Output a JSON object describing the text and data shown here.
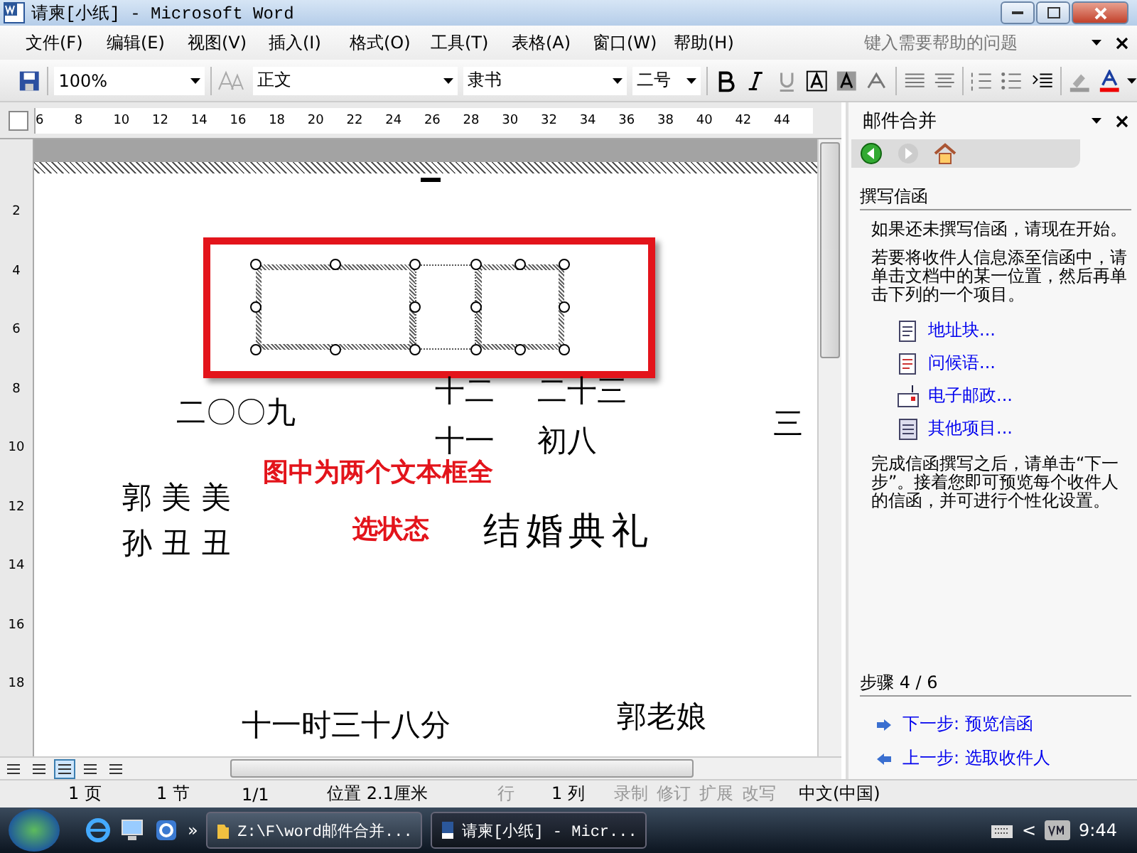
{
  "window": {
    "title": "请柬[小纸] - Microsoft Word"
  },
  "menu": {
    "items": [
      "文件(F)",
      "编辑(E)",
      "视图(V)",
      "插入(I)",
      "格式(O)",
      "工具(T)",
      "表格(A)",
      "窗口(W)",
      "帮助(H)"
    ],
    "help_placeholder": "键入需要帮助的问题"
  },
  "toolbar": {
    "zoom": "100%",
    "style": "正文",
    "font": "隶书",
    "size": "二号"
  },
  "ruler": {
    "ticks": [
      "6",
      "8",
      "10",
      "12",
      "14",
      "16",
      "18",
      "20",
      "22",
      "24",
      "26",
      "28",
      "30",
      "32",
      "34",
      "36",
      "38",
      "40",
      "42",
      "44"
    ],
    "vertical_ticks": [
      "2",
      "4",
      "6",
      "8",
      "10",
      "12",
      "14",
      "16",
      "18"
    ]
  },
  "document": {
    "texts": [
      "十二",
      "二十三",
      "十一",
      "初八",
      "二〇〇九",
      "三",
      "郭 美 美",
      "孙 丑 丑",
      "结婚典礼",
      "十一时三十八分",
      "郭老娘"
    ],
    "text_boxes": [
      {
        "selected": true
      },
      {
        "selected": true
      }
    ],
    "annotation": {
      "lines": [
        "图中为两个文本框全",
        "选状态"
      ]
    }
  },
  "view_buttons": [
    {
      "selected": false
    },
    {
      "selected": false
    },
    {
      "selected": true
    },
    {
      "selected": false
    },
    {
      "selected": false
    }
  ],
  "task_pane": {
    "title": "邮件合并",
    "section": "撰写信函",
    "intro": [
      "如果还未撰写信函，请现在开始。",
      "若要将收件人信息添至信函中，请单击文档中的某一位置，然后再单击下列的一个项目。"
    ],
    "links": [
      {
        "kind": "address",
        "label": "地址块..."
      },
      {
        "kind": "greeting",
        "label": "问候语..."
      },
      {
        "kind": "postage",
        "label": "电子邮政..."
      },
      {
        "kind": "more",
        "label": "其他项目..."
      }
    ],
    "outro": "完成信函撰写之后，请单击“下一步”。接着您即可预览每个收件人的信函，并可进行个性化设置。",
    "step": "步骤 4 / 6",
    "next": "下一步: 预览信函",
    "prev": "上一步: 选取收件人"
  },
  "status_bar": [
    {
      "text": "1 页",
      "disabled": false
    },
    {
      "text": "1 节",
      "disabled": false
    },
    {
      "text": "1/1",
      "disabled": false
    },
    {
      "text": "位置 2.1厘米",
      "disabled": false
    },
    {
      "text": "行",
      "disabled": true
    },
    {
      "text": "1 列",
      "disabled": false
    },
    {
      "text": "录制",
      "disabled": true
    },
    {
      "text": "修订",
      "disabled": true
    },
    {
      "text": "扩展",
      "disabled": true
    },
    {
      "text": "改写",
      "disabled": true
    },
    {
      "text": "中文(中国)",
      "disabled": false
    }
  ],
  "taskbar": {
    "more": "»",
    "tasks": [
      {
        "label": "Z:\\F\\word邮件合并...",
        "selected": false
      },
      {
        "label": "请柬[小纸] - Micr...",
        "selected": true
      }
    ],
    "tray_arrow": "<",
    "time": "9:44"
  }
}
